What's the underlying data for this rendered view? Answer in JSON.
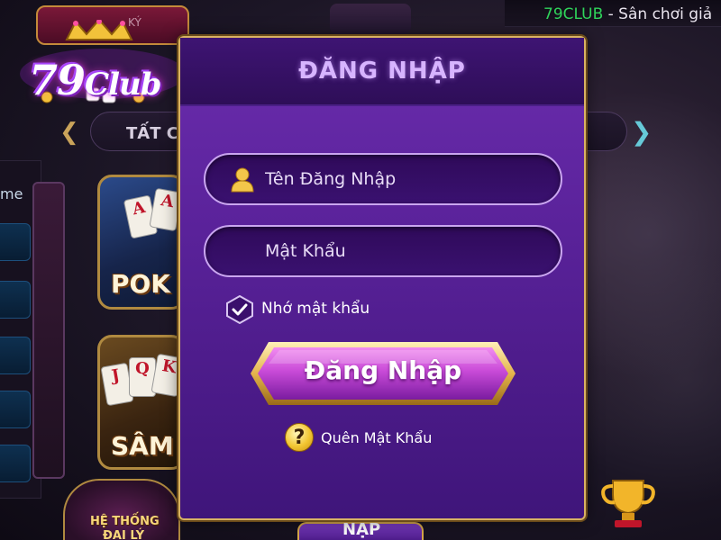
{
  "background": {
    "marquee_brand": "79CLUB",
    "marquee_text": " - Sân chơi giả",
    "category_label": "TẤT CẢ",
    "side_label": "me",
    "tiles": [
      {
        "label": "POK",
        "card_ranks": [
          "A",
          "A"
        ]
      },
      {
        "label": "SÂM",
        "card_ranks": [
          "J",
          "Q",
          "K"
        ]
      }
    ],
    "top_plaque_text": "KÝ",
    "emblem_line1": "HỆ THỐNG",
    "emblem_line2": "ĐẠI LÝ",
    "nap_label": "NẠP"
  },
  "logo": {
    "main": "79",
    "sub": "Club"
  },
  "dialog": {
    "title": "ĐĂNG NHẬP",
    "username": {
      "placeholder": "Tên Đăng Nhập",
      "value": ""
    },
    "password": {
      "placeholder": "Mật Khẩu",
      "value": ""
    },
    "remember": {
      "label": "Nhớ mật khẩu",
      "checked": true
    },
    "login_button": "Đăng Nhập",
    "forgot_label": "Quên Mật Khẩu",
    "forgot_icon": "?"
  },
  "colors": {
    "dialog_purple": "#5a229a",
    "gold_border": "#d9b263",
    "brand_green": "#2fd35a",
    "button_pink": "#c94bd8"
  },
  "icons": {
    "user": "user-icon",
    "checkbox": "check-icon",
    "help": "question-icon",
    "nav_left": "chevron-left-icon",
    "nav_right": "chevron-right-icon"
  }
}
